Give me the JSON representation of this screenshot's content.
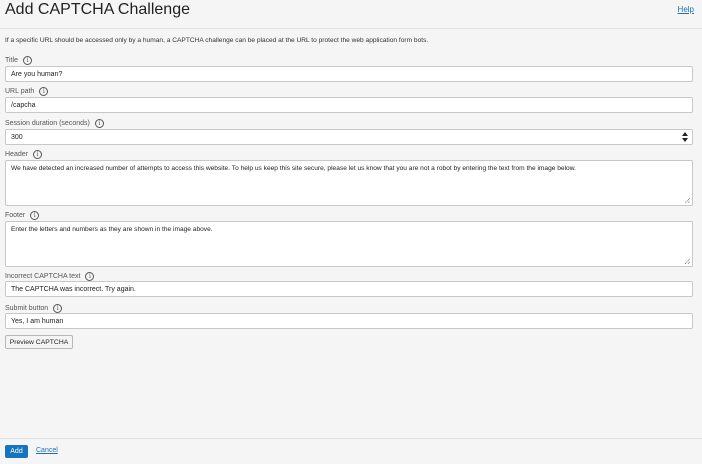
{
  "header": {
    "title": "Add CAPTCHA Challenge",
    "help_label": "Help"
  },
  "intro": "If a specific URL should be accessed only by a human, a CAPTCHA challenge can be placed at the URL to protect the web application form bots.",
  "info_icon_glyph": "i",
  "form": {
    "title": {
      "label": "Title",
      "value": "Are you human?"
    },
    "url_path": {
      "label": "URL path",
      "value": "/capcha"
    },
    "session_duration": {
      "label": "Session duration (seconds)",
      "value": "300"
    },
    "header": {
      "label": "Header",
      "value": "We have detected an increased number of attempts to access this website. To help us keep this site secure, please let us know that you are not a robot by entering the text from the image below."
    },
    "footer": {
      "label": "Footer",
      "value": "Enter the letters and numbers as they are shown in the image above."
    },
    "incorrect_text": {
      "label": "Incorrect CAPTCHA text",
      "value": "The CAPTCHA was incorrect. Try again."
    },
    "submit_button": {
      "label": "Submit button",
      "value": "Yes, I am human"
    }
  },
  "preview_button_label": "Preview CAPTCHA",
  "footer": {
    "add_label": "Add",
    "cancel_label": "Cancel"
  },
  "colors": {
    "primary": "#1474bf",
    "link": "#1f6fb2",
    "background": "#f5f5f5"
  },
  "icons": [
    "info-icon",
    "spinner-up-icon",
    "spinner-down-icon",
    "resize-grip-icon"
  ]
}
